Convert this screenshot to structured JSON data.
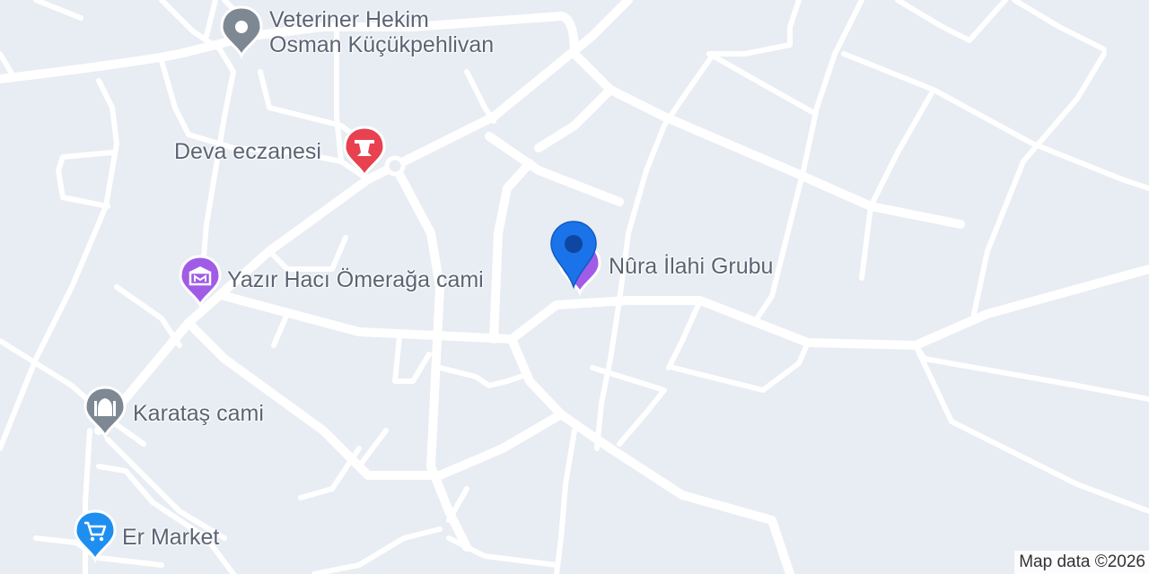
{
  "map": {
    "background_color": "#e8ecf3",
    "road_color": "#ffffff",
    "attribution": "Map data ©2026"
  },
  "pois": [
    {
      "id": "veteriner",
      "label_line1": "Veteriner Hekim",
      "label_line2": "Osman Küçükpehlivan",
      "icon": "location-dot-icon",
      "color": "#7d8893"
    },
    {
      "id": "deva",
      "label": "Deva eczanesi",
      "icon": "pharmacy-icon",
      "color": "#e8414f"
    },
    {
      "id": "yazir",
      "label": "Yazır Hacı Ömerağa cami",
      "icon": "museum-icon",
      "color": "#a05ce6"
    },
    {
      "id": "karatas",
      "label": "Karataş cami",
      "icon": "mosque-icon",
      "color": "#7d8893"
    },
    {
      "id": "ermarket",
      "label": "Er Market",
      "icon": "shopping-cart-icon",
      "color": "#1e8ff0"
    },
    {
      "id": "nura",
      "label": "Nûra İlahi Grubu",
      "icon": "music-note-icon",
      "color": "#a05ce6"
    }
  ],
  "selected_marker": {
    "icon": "selected-location-pin-icon",
    "color": "#1a73e8"
  }
}
